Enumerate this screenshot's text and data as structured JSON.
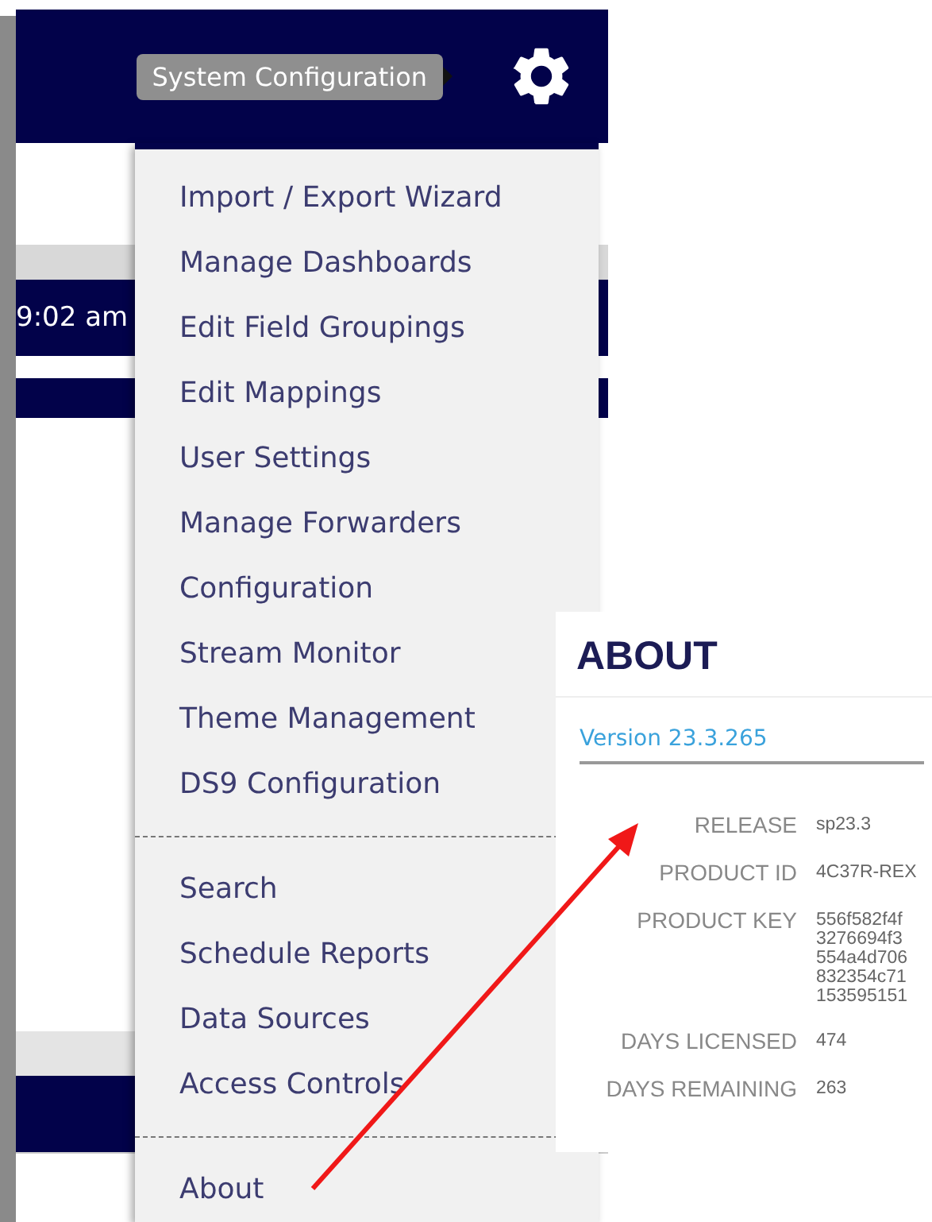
{
  "header": {
    "tooltip": "System Configuration"
  },
  "background": {
    "time": "9:02 am"
  },
  "menu": {
    "groups": [
      [
        "Import / Export Wizard",
        "Manage Dashboards",
        "Edit Field Groupings",
        "Edit Mappings",
        "User Settings",
        "Manage Forwarders",
        "Configuration",
        "Stream Monitor",
        "Theme Management",
        "DS9 Configuration"
      ],
      [
        "Search",
        "Schedule Reports",
        "Data Sources",
        "Access Controls"
      ],
      [
        "About"
      ]
    ]
  },
  "about": {
    "title": "ABOUT",
    "version": "Version 23.3.265",
    "fields": [
      {
        "label": "RELEASE",
        "value": "sp23.3"
      },
      {
        "label": "PRODUCT ID",
        "value": "4C37R-REX"
      },
      {
        "label": "PRODUCT KEY",
        "value": "556f582f4f\n3276694f3\n554a4d706\n832354c71\n153595151"
      },
      {
        "label": "DAYS LICENSED",
        "value": "474"
      },
      {
        "label": "DAYS REMAINING",
        "value": "263"
      }
    ]
  }
}
